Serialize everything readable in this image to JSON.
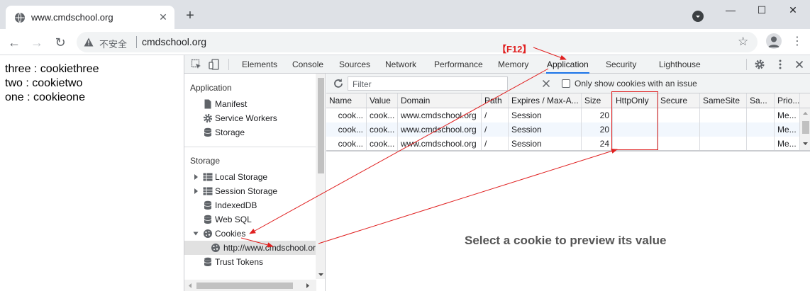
{
  "browser": {
    "tab_title": "www.cmdschool.org",
    "tab_close": "✕",
    "new_tab": "+",
    "win_minimize": "—",
    "win_restore": "☐",
    "win_close": "✕",
    "back": "←",
    "forward": "→",
    "reload": "↻",
    "insecure_label": "不安全",
    "url": "cmdschool.org",
    "star": "☆",
    "menu": "⋮"
  },
  "page": {
    "lines": [
      "three : cookiethree",
      "two : cookietwo",
      "one : cookieone"
    ]
  },
  "devtools": {
    "tabs": [
      "Elements",
      "Console",
      "Sources",
      "Network",
      "Performance",
      "Memory",
      "Application",
      "Security",
      "Lighthouse"
    ],
    "active_tab": "Application",
    "sidebar": {
      "application_header": "Application",
      "application_items": [
        "Manifest",
        "Service Workers",
        "Storage"
      ],
      "storage_header": "Storage",
      "storage_items": [
        "Local Storage",
        "Session Storage",
        "IndexedDB",
        "Web SQL",
        "Cookies"
      ],
      "cookie_origin": "http://www.cmdschool.org",
      "trust_tokens": "Trust Tokens"
    },
    "filter_placeholder": "Filter",
    "clear_icon": "⃠",
    "only_issue_label": "Only show cookies with an issue",
    "columns": [
      "Name",
      "Value",
      "Domain",
      "Path",
      "Expires / Max-A...",
      "Size",
      "HttpOnly",
      "Secure",
      "SameSite",
      "Sa...",
      "Prio..."
    ],
    "rows": [
      {
        "name": "cook...",
        "value": "cook...",
        "domain": "www.cmdschool.org",
        "path": "/",
        "expires": "Session",
        "size": "20",
        "httponly": "",
        "secure": "",
        "samesite": "",
        "sa": "",
        "priority": "Me..."
      },
      {
        "name": "cook...",
        "value": "cook...",
        "domain": "www.cmdschool.org",
        "path": "/",
        "expires": "Session",
        "size": "20",
        "httponly": "",
        "secure": "",
        "samesite": "",
        "sa": "",
        "priority": "Me..."
      },
      {
        "name": "cook...",
        "value": "cook...",
        "domain": "www.cmdschool.org",
        "path": "/",
        "expires": "Session",
        "size": "24",
        "httponly": "",
        "secure": "",
        "samesite": "",
        "sa": "",
        "priority": "Me..."
      }
    ],
    "preview_message": "Select a cookie to preview its value"
  },
  "annotation": {
    "label": "【F12】",
    "color": "#e02020"
  }
}
